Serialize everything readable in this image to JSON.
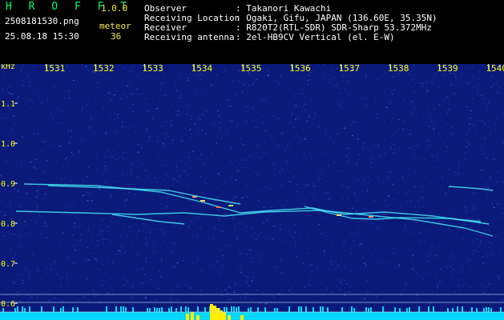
{
  "app": {
    "name": "H R O F F T",
    "version": "1.0.0"
  },
  "file": {
    "name": "2508181530.png",
    "datetime": "25.08.18 15:30"
  },
  "meteor": {
    "label": "meteor",
    "count": "36"
  },
  "info": {
    "labels": [
      "Observer",
      "Receiving Location",
      "Receiver",
      "Receiving antenna"
    ],
    "values": [
      ": Takanori Kawachi",
      ": Ogaki, Gifu, JAPAN (136.60E, 35.35N)",
      ": R820T2(RTL-SDR) SDR-Sharp 53.372MHz",
      ": 2el-HB9CV Vertical (el. E-W)"
    ]
  },
  "axes": {
    "y_unit": "kHz",
    "y_ticks": [
      "1.1",
      "1.0",
      "0.9",
      "0.8",
      "0.7",
      "0.6"
    ],
    "x_ticks": [
      "1531",
      "1532",
      "1533",
      "1534",
      "1535",
      "1536",
      "1537",
      "1538",
      "1539",
      "1540"
    ]
  },
  "colors": {
    "background": "#000000",
    "spectrum_base": "#0a1a7a",
    "noise": "#3d63ff",
    "header_text": "#ffffff",
    "tick_text": "#ffff00",
    "logo": "#00ff66",
    "bar": "#00d8ff",
    "bar_peak": "#ffee00",
    "trace": "#49f0ff"
  }
}
